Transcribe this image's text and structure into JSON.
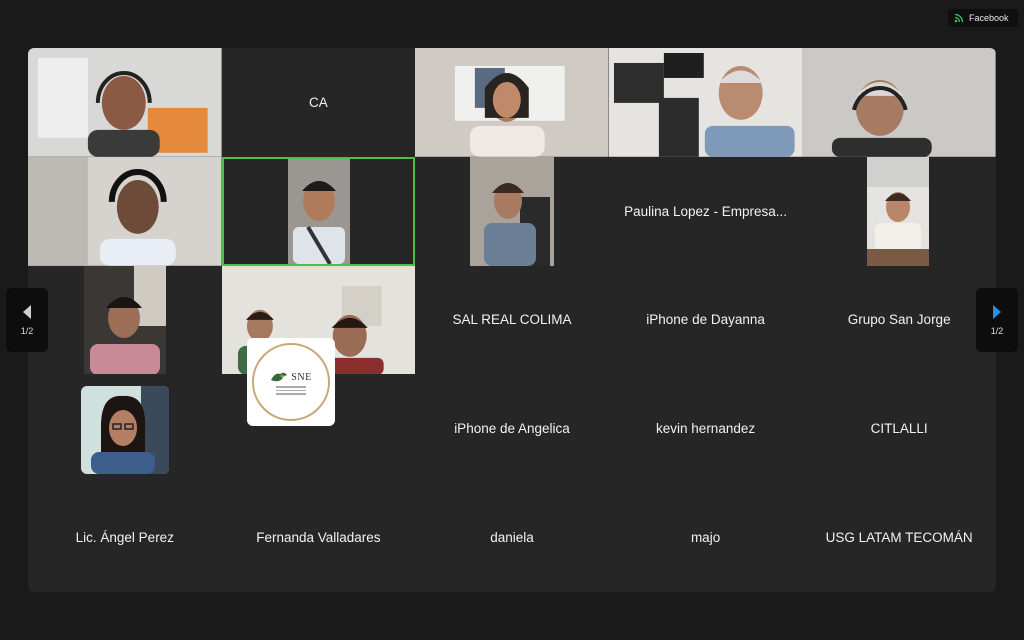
{
  "live": {
    "label": "Facebook",
    "icon": "broadcast-icon"
  },
  "pagination": {
    "left": "1/2",
    "right": "1/2"
  },
  "tiles": {
    "ca": "CA",
    "paulina": "Paulina Lopez - Empresa...",
    "sal_real": "SAL REAL COLIMA",
    "iphone_dayanna": "iPhone de Dayanna",
    "grupo_san_jorge": "Grupo San Jorge",
    "iphone_angelica": "iPhone de Angelica",
    "kevin": "kevin hernandez",
    "citlalli": "CITLALLI",
    "lic_angel": "Lic. Ángel Perez",
    "fernanda": "Fernanda Valladares",
    "daniela": "daniela",
    "majo": "majo",
    "usg": "USG LATAM TECOMÁN"
  },
  "logo": {
    "text": "SNE"
  },
  "colors": {
    "background": "#1a1a1a",
    "grid": "#262626",
    "active_speaker": "#4bbf4b",
    "nav_arrow_right": "#2b8fe0"
  }
}
